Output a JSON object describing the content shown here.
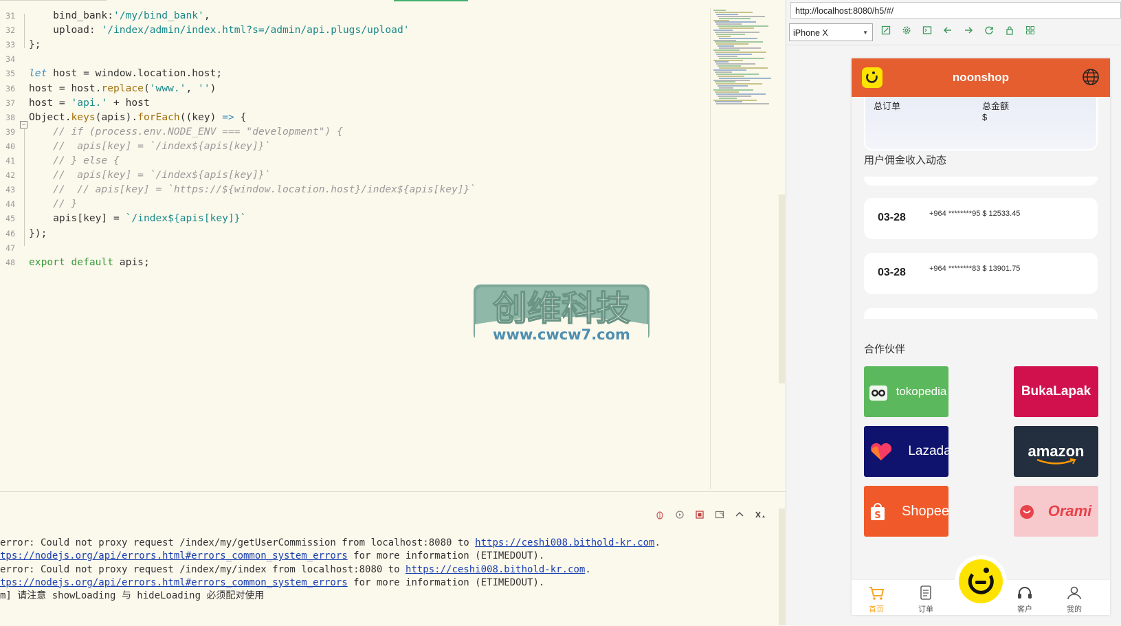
{
  "editor": {
    "lines": [
      {
        "n": "31",
        "parts": [
          [
            "pl",
            "    bind_bank:"
          ],
          [
            "str",
            "'/my/bind_bank'"
          ],
          [
            "pl",
            ",",
            ""
          ]
        ]
      },
      {
        "n": "32",
        "parts": [
          [
            "pl",
            "    upload: "
          ],
          [
            "str",
            "'/index/admin/index.html?s=/admin/api.plugs/upload'"
          ]
        ]
      },
      {
        "n": "33",
        "parts": [
          [
            "pl",
            "};"
          ]
        ]
      },
      {
        "n": "34",
        "parts": []
      },
      {
        "n": "35",
        "parts": [
          [
            "kw",
            "let"
          ],
          [
            "pl",
            " host = window.location.host;"
          ]
        ]
      },
      {
        "n": "36",
        "parts": [
          [
            "pl",
            "host = host."
          ],
          [
            "fn",
            "replace"
          ],
          [
            "pl",
            "("
          ],
          [
            "str",
            "'www.'"
          ],
          [
            "pl",
            ", "
          ],
          [
            "str",
            "''"
          ],
          [
            "pl",
            ")"
          ]
        ]
      },
      {
        "n": "37",
        "parts": [
          [
            "pl",
            "host = "
          ],
          [
            "str",
            "'api.'"
          ],
          [
            "pl",
            " + host"
          ]
        ]
      },
      {
        "n": "38",
        "parts": [
          [
            "pl",
            "Object."
          ],
          [
            "fn",
            "keys"
          ],
          [
            "pl",
            "(apis)."
          ],
          [
            "fn",
            "forEach"
          ],
          [
            "pl",
            "((key) "
          ],
          [
            "kw",
            "=>"
          ],
          [
            "pl",
            " {"
          ]
        ]
      },
      {
        "n": "39",
        "parts": [
          [
            "cm",
            "    // if (process.env.NODE_ENV === \"development\") {"
          ]
        ]
      },
      {
        "n": "40",
        "parts": [
          [
            "cm",
            "    //  apis[key] = `/index${apis[key]}`"
          ]
        ]
      },
      {
        "n": "41",
        "parts": [
          [
            "cm",
            "    // } else {"
          ]
        ]
      },
      {
        "n": "42",
        "parts": [
          [
            "cm",
            "    //  apis[key] = `/index${apis[key]}`"
          ]
        ]
      },
      {
        "n": "43",
        "parts": [
          [
            "cm",
            "    //  // apis[key] = `https://${window.location.host}/index${apis[key]}`"
          ]
        ]
      },
      {
        "n": "44",
        "parts": [
          [
            "cm",
            "    // }"
          ]
        ]
      },
      {
        "n": "45",
        "parts": [
          [
            "pl",
            "    apis[key] = "
          ],
          [
            "str",
            "`/index${apis[key]}`"
          ]
        ]
      },
      {
        "n": "46",
        "parts": [
          [
            "pl",
            "});"
          ]
        ]
      },
      {
        "n": "47",
        "parts": []
      },
      {
        "n": "48",
        "parts": [
          [
            "ex",
            "export default"
          ],
          [
            "pl",
            " apis;"
          ]
        ]
      }
    ]
  },
  "watermark": {
    "title": "创维科技",
    "url": "www.cwcw7.com"
  },
  "console": {
    "lines": [
      [
        [
          "pl",
          "error: Could not proxy request /index/my/getUserCommission from localhost:8080 to "
        ],
        [
          "link",
          "https://ceshi008.bithold-kr.com"
        ],
        [
          "pl",
          "."
        ]
      ],
      [
        [
          "link",
          "tps://nodejs.org/api/errors.html#errors_common_system_errors"
        ],
        [
          "pl",
          " for more information (ETIMEDOUT)."
        ]
      ],
      [
        [
          "pl",
          "error: Could not proxy request /index/my/index from localhost:8080 to "
        ],
        [
          "link",
          "https://ceshi008.bithold-kr.com"
        ],
        [
          "pl",
          "."
        ]
      ],
      [
        [
          "link",
          "tps://nodejs.org/api/errors.html#errors_common_system_errors"
        ],
        [
          "pl",
          " for more information (ETIMEDOUT)."
        ]
      ],
      [
        [
          "pl",
          "m] 请注意 showLoading 与 hideLoading 必须配对使用"
        ]
      ]
    ]
  },
  "browser": {
    "url": "http://localhost:8080/h5/#/",
    "device": "iPhone X"
  },
  "app": {
    "title": "noonshop",
    "stats": {
      "orders_label": "总订单",
      "amount_label": "总金额",
      "amount_value": "$"
    },
    "commission_title": "用户佣金收入动态",
    "transactions": [
      {
        "date": "03-28",
        "info": "+964 ********95 $ 12533.45"
      },
      {
        "date": "03-28",
        "info": "+964 ********83 $ 13901.75"
      }
    ],
    "partners_title": "合作伙伴",
    "partners": [
      {
        "name": "tokopedia",
        "color": "#5cb85c"
      },
      {
        "name": "BukaLapak",
        "color": "#d1114d"
      },
      {
        "name": "Lazada",
        "color": "#0f136e"
      },
      {
        "name": "amazon",
        "color": "#232f3e"
      },
      {
        "name": "Shopee",
        "color": "#f05a2b"
      },
      {
        "name": "Orami",
        "color": "#f7c9cc"
      }
    ],
    "tabs": [
      {
        "label": "首页",
        "active": true
      },
      {
        "label": "订单",
        "active": false
      },
      {
        "label": "客户",
        "active": false
      },
      {
        "label": "我的",
        "active": false
      }
    ]
  },
  "colors": {
    "accent": "#e55e2f",
    "brand_yellow": "#ffe300",
    "active_tab": "#f5a623"
  }
}
